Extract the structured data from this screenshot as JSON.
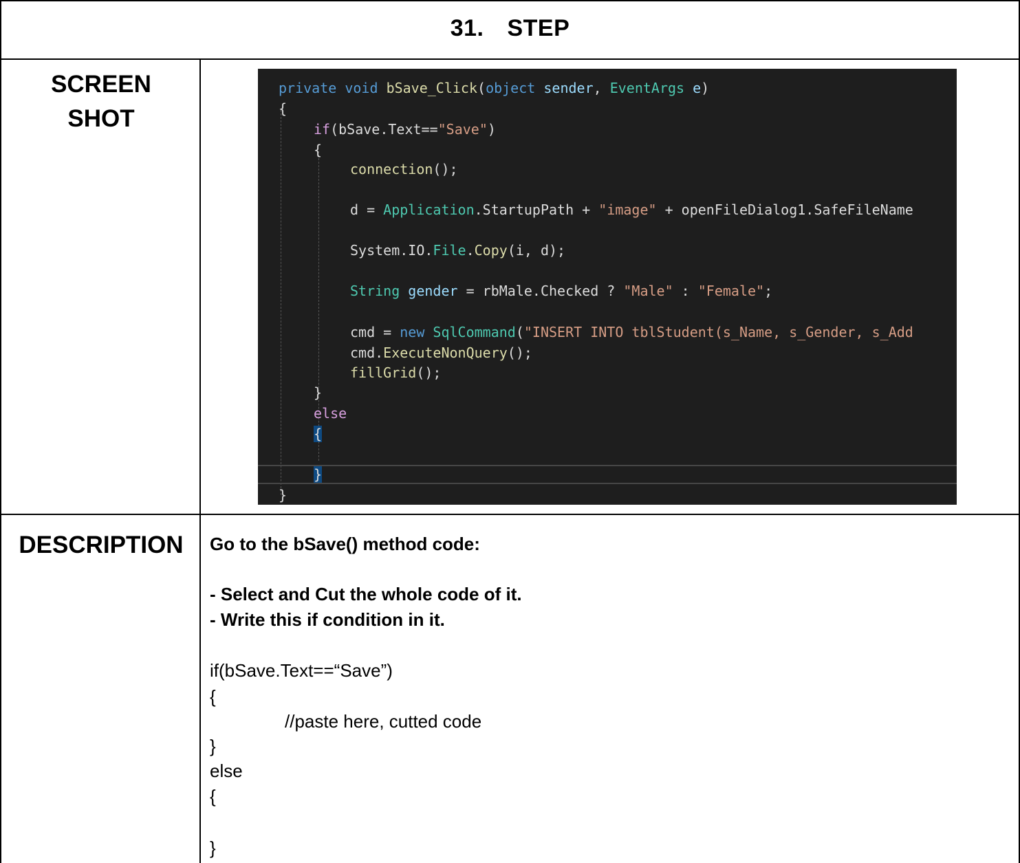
{
  "step": {
    "number": "31.",
    "label": "STEP"
  },
  "labels": {
    "screenshot_line1": "SCREEN",
    "screenshot_line2": "SHOT",
    "description": "DESCRIPTION"
  },
  "code_screenshot": {
    "colors": {
      "background": "#1e1e1e",
      "keyword": "#569cd6",
      "control": "#d8a0df",
      "type": "#4ec9b0",
      "string": "#d69d85",
      "text": "#dcdcdc"
    },
    "lines": [
      "private void bSave_Click(object sender, EventArgs e)",
      "{",
      "if(bSave.Text==\"Save\")",
      "{",
      "connection();",
      "d = Application.StartupPath + \"image\" + openFileDialog1.SafeFileName",
      "System.IO.File.Copy(i, d);",
      "String gender = rbMale.Checked ? \"Male\" : \"Female\";",
      "cmd = new SqlCommand(\"INSERT INTO tblStudent(s_Name, s_Gender, s_Add",
      "cmd.ExecuteNonQuery();",
      "fillGrid();",
      "}",
      "else",
      "{",
      "}",
      "}"
    ]
  },
  "description": {
    "intro": "Go to the bSave() method code:",
    "bullet1": "- Select and Cut the whole code of it.",
    "bullet2": "- Write this if condition in it.",
    "code": [
      "if(bSave.Text==“Save”)",
      "{",
      "//paste here, cutted code",
      "}",
      "else",
      "{",
      "}"
    ]
  }
}
